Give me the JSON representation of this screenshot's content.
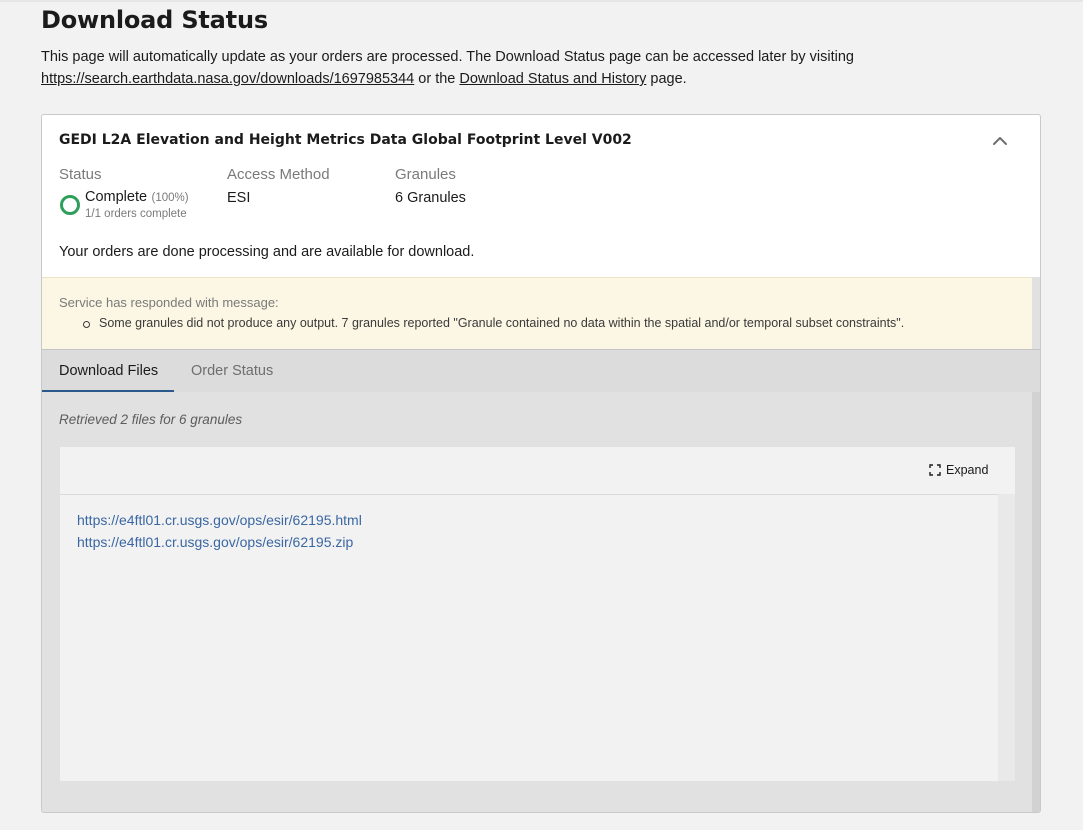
{
  "page": {
    "title": "Download Status",
    "intro_text_1": "This page will automatically update as your orders are processed. The Download Status page can be accessed later by visiting ",
    "intro_link_url": "https://search.earthdata.nasa.gov/downloads/1697985344",
    "intro_text_2": " or the ",
    "intro_link_history": "Download Status and History",
    "intro_text_3": " page."
  },
  "collection": {
    "title": "GEDI L2A Elevation and Height Metrics Data Global Footprint Level V002",
    "collapse_icon": "chevron-up-icon",
    "status_label": "Status",
    "status_value": "Complete",
    "status_percent": "(100%)",
    "status_orders": "1/1 orders complete",
    "status_color": "#2e9e5b",
    "access_label": "Access Method",
    "access_value": "ESI",
    "granules_label": "Granules",
    "granules_value": "6 Granules",
    "done_message": "Your orders are done processing and are available for download."
  },
  "service": {
    "title": "Service has responded with message:",
    "messages": [
      "Some granules did not produce any output. 7 granules reported \"Granule contained no data within the spatial and/or temporal subset constraints\"."
    ]
  },
  "tabs": [
    {
      "label": "Download Files",
      "active": true
    },
    {
      "label": "Order Status",
      "active": false
    }
  ],
  "files": {
    "retrieved_text": "Retrieved 2 files for 6 granules",
    "expand_label": "Expand",
    "expand_icon": "expand-icon",
    "links": [
      "https://e4ftl01.cr.usgs.gov/ops/esir/62195.html",
      "https://e4ftl01.cr.usgs.gov/ops/esir/62195.zip"
    ]
  },
  "colors": {
    "accent_tab": "#2a5a8c",
    "link": "#3a67a3",
    "notice_bg": "#fcf6e4"
  }
}
